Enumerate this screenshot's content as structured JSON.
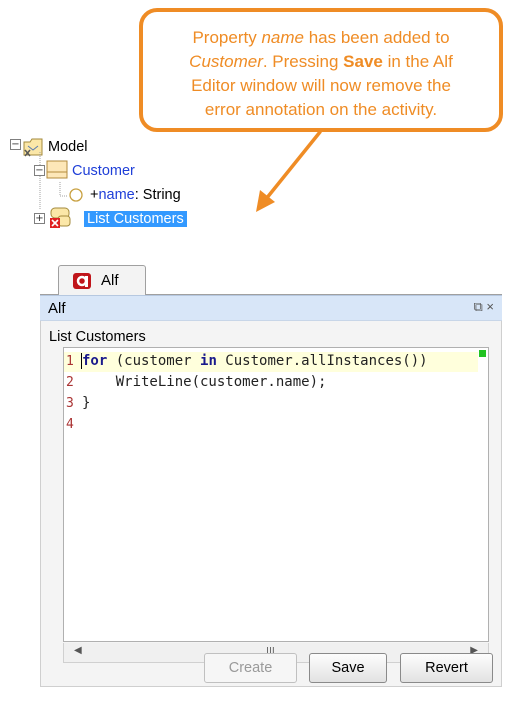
{
  "callout": {
    "line1_a": "Property ",
    "line1_b": "name",
    "line1_c": " has been added to",
    "line2_a": "Customer",
    "line2_b": ". Pressing ",
    "line2_c": "Save",
    "line2_d": " in the Alf",
    "line3": "Editor window will now remove the",
    "line4": "error annotation on the activity."
  },
  "tree": {
    "model": "Model",
    "customer": "Customer",
    "property_prefix": "+",
    "property_name": "name",
    "property_type": " : String",
    "activity": "List Customers"
  },
  "panel": {
    "tab_label": "Alf",
    "title": "Alf",
    "editor_label": "List Customers",
    "controls": "⧉ ×",
    "lines": [
      {
        "no": "1"
      },
      {
        "no": "2",
        "text": "    WriteLine(customer.name);"
      },
      {
        "no": "3",
        "text": "}"
      },
      {
        "no": "4"
      }
    ],
    "line1": {
      "kw1": "for",
      "mid1": " (customer ",
      "kw2": "in",
      "mid2": " Customer.allInstances())"
    },
    "scroll_thumb": "III",
    "buttons": {
      "create": "Create",
      "save": "Save",
      "revert": "Revert"
    }
  },
  "colors": {
    "callout": "#ef8c25",
    "selection": "#3399ff",
    "link_blue": "#1f3fd8"
  }
}
